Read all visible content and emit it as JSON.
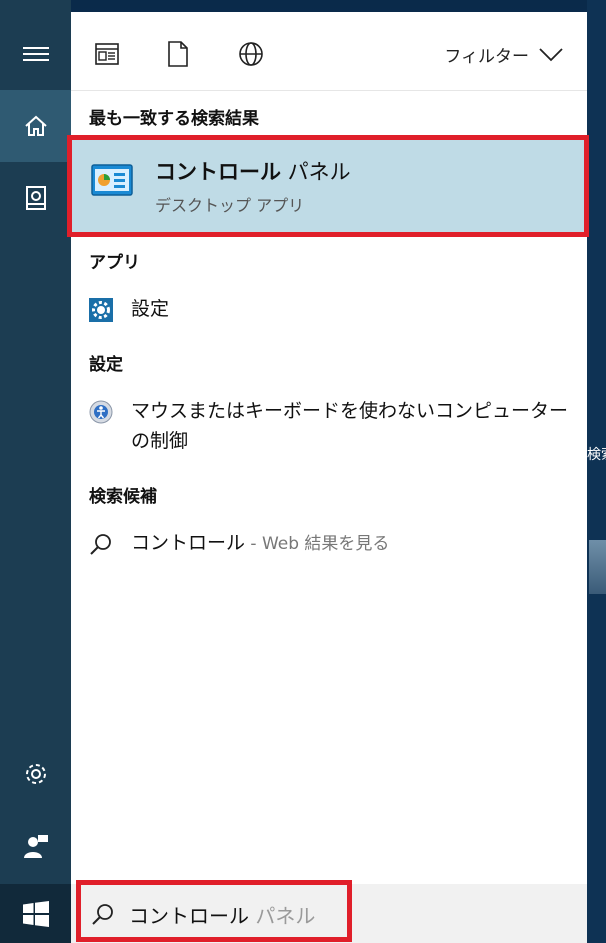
{
  "toolbar": {
    "filter_label": "フィルター",
    "icons": [
      "apps-icon",
      "document-icon",
      "web-globe-icon"
    ]
  },
  "rail": {
    "items": [
      "menu-hamburger-icon",
      "home-icon",
      "notebook-icon",
      "settings-gear-icon",
      "feedback-person-icon"
    ]
  },
  "best_match": {
    "heading": "最も一致する検索結果",
    "title_bold": "コントロール",
    "title_rest": " パネル",
    "subtitle": "デスクトップ アプリ"
  },
  "apps": {
    "heading": "アプリ",
    "items": [
      {
        "label": "設定",
        "icon": "settings-gear-icon"
      }
    ]
  },
  "settings": {
    "heading": "設定",
    "items": [
      {
        "label": "マウスまたはキーボードを使わないコンピューターの制御",
        "icon": "ease-of-access-icon"
      }
    ]
  },
  "suggestions": {
    "heading": "検索候補",
    "items": [
      {
        "query": "コントロール",
        "suffix": " - Web 結果を見る",
        "icon": "search-icon"
      }
    ]
  },
  "search": {
    "typed": "コントロール",
    "placeholder_completion": " パネル"
  },
  "edge": {
    "peek_text": "検索"
  },
  "colors": {
    "rail_bg": "#1c3d52",
    "rail_active": "#2f5a72",
    "best_match_bg": "#bfdbe6",
    "highlight_outline": "#e01f2a",
    "accent": "#1a8ad4"
  }
}
